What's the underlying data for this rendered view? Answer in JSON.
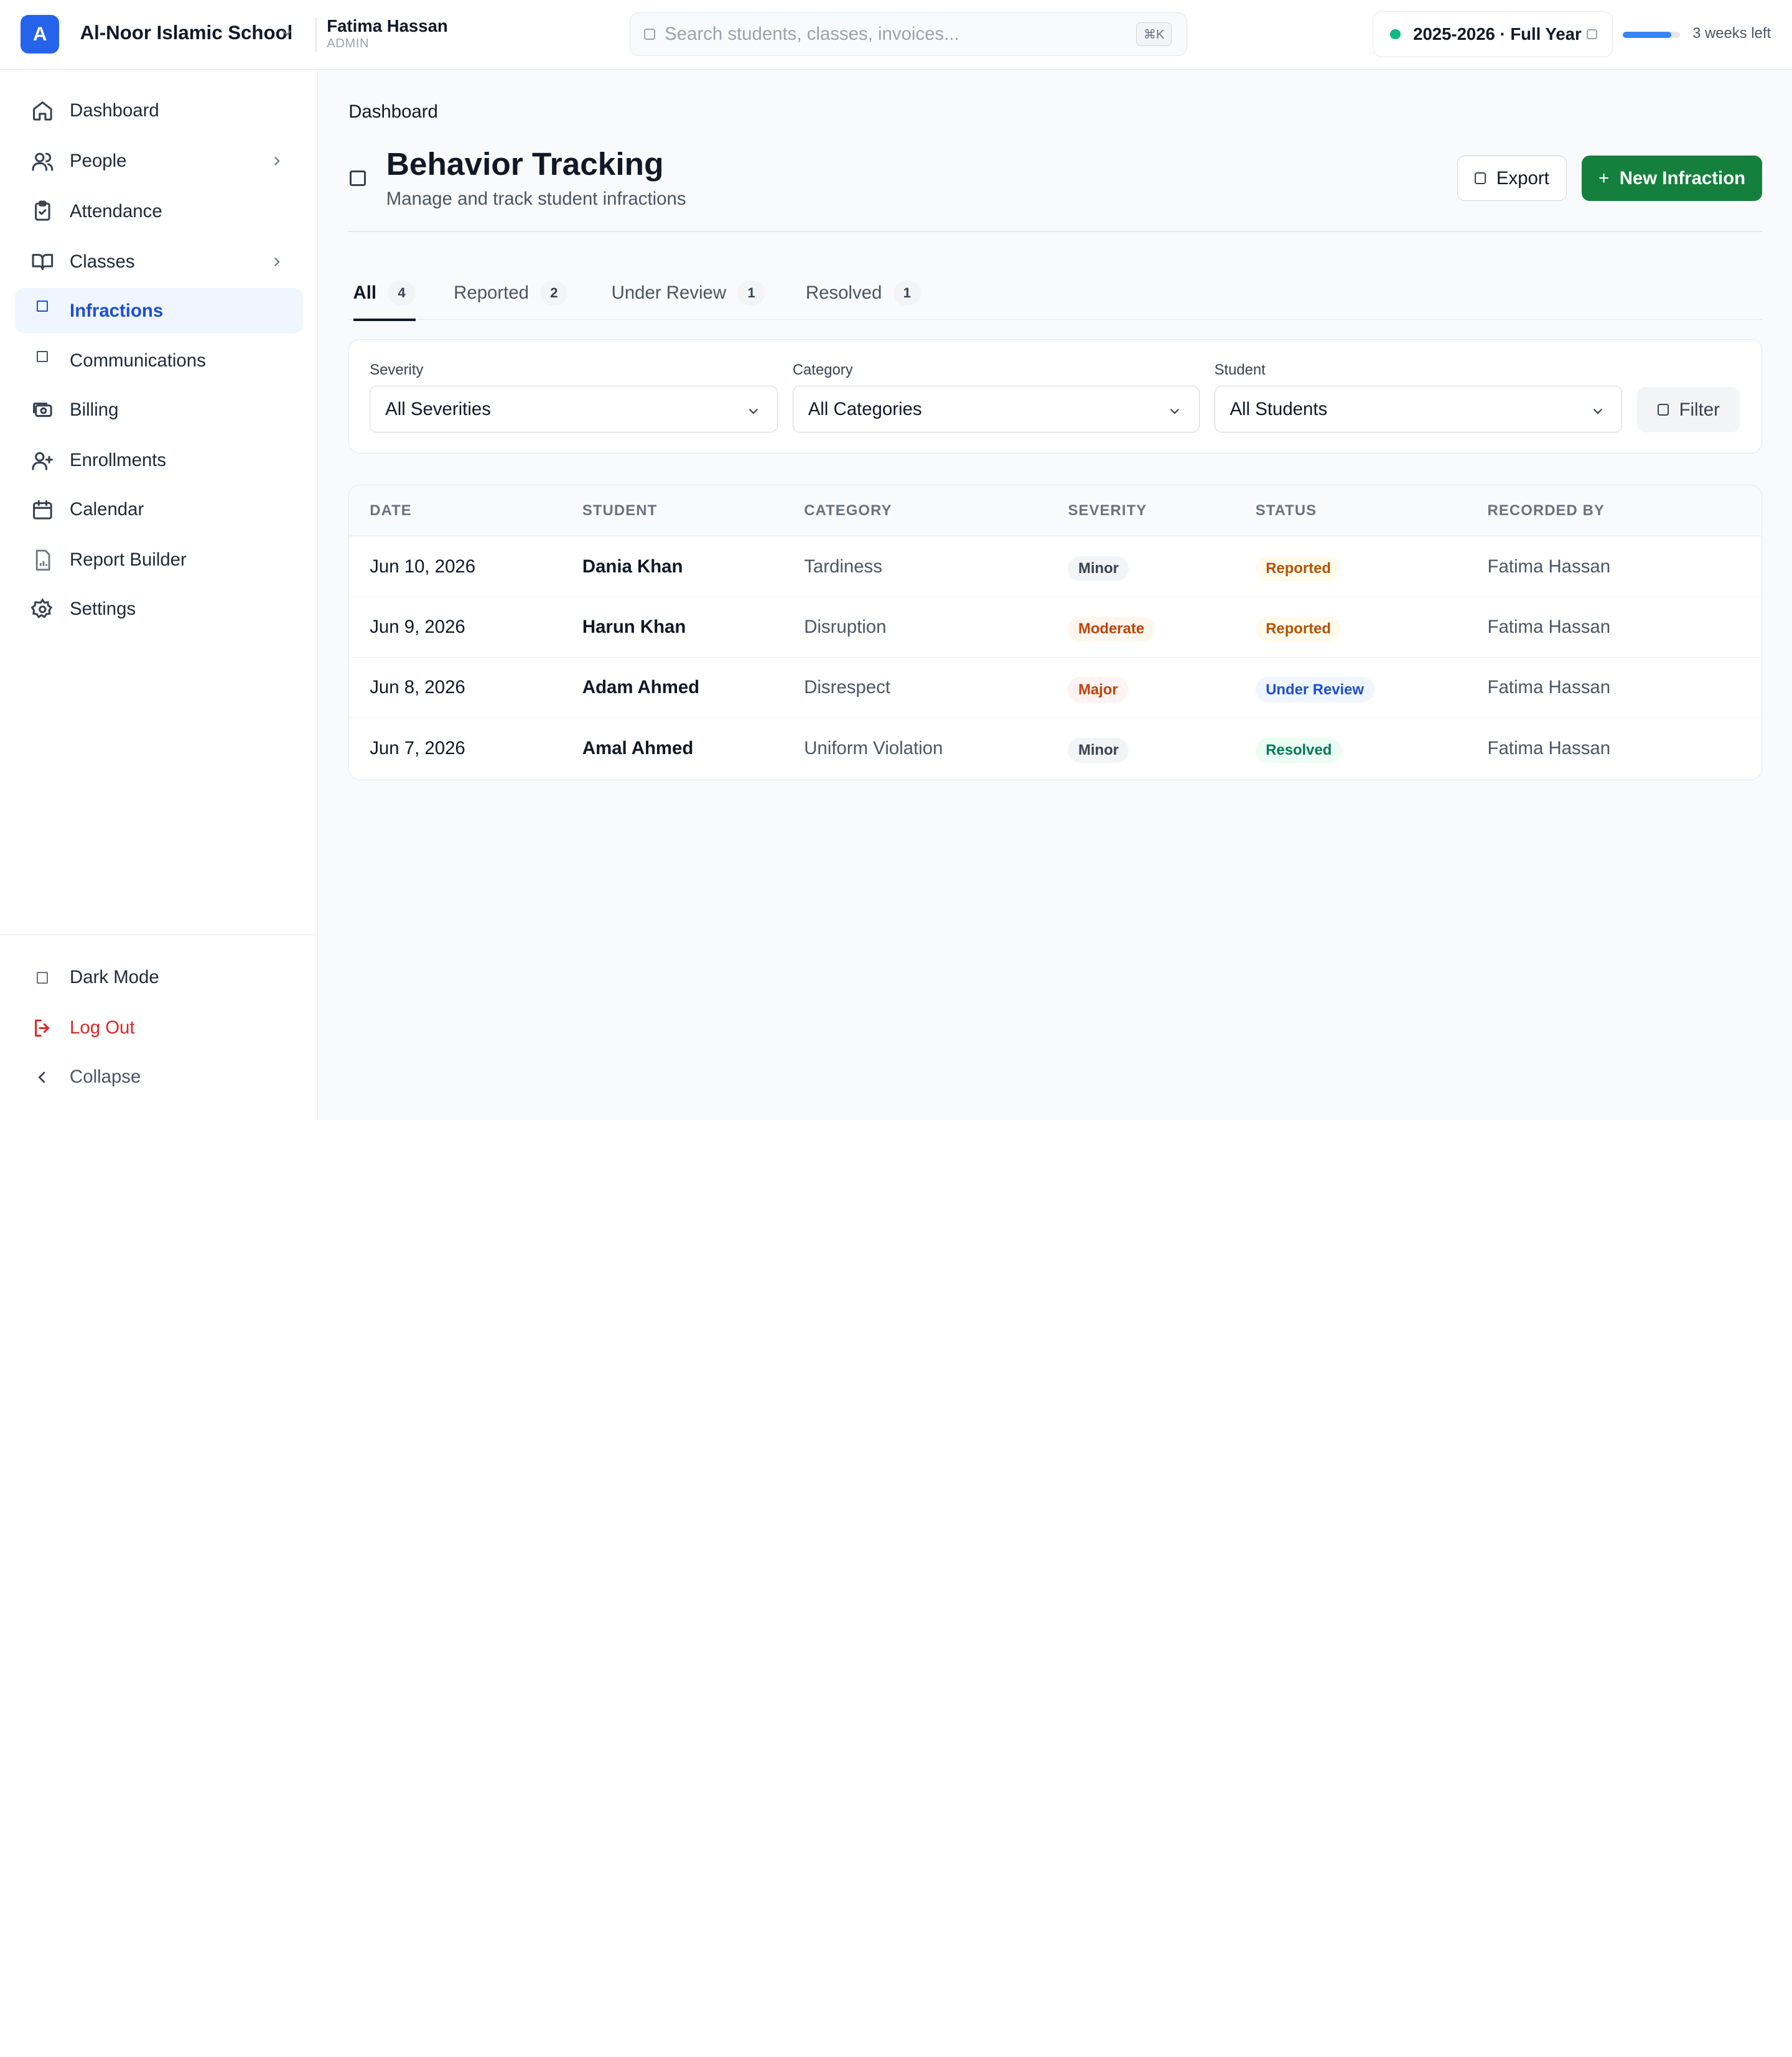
{
  "header": {
    "logo_letter": "A",
    "school_name": "Al-Noor Islamic School",
    "user_name": "Fatima Hassan",
    "user_role": "ADMIN",
    "search_placeholder": "Search students, classes, invoices...",
    "search_shortcut": "⌘K",
    "year_label": "2025-2026 · Full Year",
    "year_progress_percent": 85,
    "weeks_left": "3 weeks left"
  },
  "sidebar": {
    "items": [
      {
        "label": "Dashboard",
        "icon": "home-icon"
      },
      {
        "label": "People",
        "icon": "users-icon",
        "expandable": true
      },
      {
        "label": "Attendance",
        "icon": "clipboard-check-icon"
      },
      {
        "label": "Classes",
        "icon": "book-open-icon",
        "expandable": true
      },
      {
        "label": "Infractions",
        "icon": "square-icon",
        "active": true
      },
      {
        "label": "Communications",
        "icon": "square-icon"
      },
      {
        "label": "Billing",
        "icon": "banknote-icon"
      },
      {
        "label": "Enrollments",
        "icon": "user-plus-icon"
      },
      {
        "label": "Calendar",
        "icon": "calendar-icon"
      },
      {
        "label": "Report Builder",
        "icon": "file-chart-icon"
      },
      {
        "label": "Settings",
        "icon": "gear-icon"
      }
    ],
    "bottom": {
      "dark_mode": "Dark Mode",
      "log_out": "Log Out",
      "collapse": "Collapse"
    }
  },
  "page": {
    "breadcrumb": "Dashboard",
    "title": "Behavior Tracking",
    "subtitle": "Manage and track student infractions",
    "export_label": "Export",
    "new_label": "New Infraction",
    "new_prefix": "+"
  },
  "tabs": [
    {
      "label": "All",
      "count": "4",
      "active": true
    },
    {
      "label": "Reported",
      "count": "2"
    },
    {
      "label": "Under Review",
      "count": "1"
    },
    {
      "label": "Resolved",
      "count": "1"
    }
  ],
  "filters": {
    "severity": {
      "label": "Severity",
      "value": "All Severities"
    },
    "category": {
      "label": "Category",
      "value": "All Categories"
    },
    "student": {
      "label": "Student",
      "value": "All Students"
    },
    "filter_button": "Filter"
  },
  "table": {
    "columns": [
      "DATE",
      "STUDENT",
      "CATEGORY",
      "SEVERITY",
      "STATUS",
      "RECORDED BY"
    ],
    "rows": [
      {
        "date": "Jun 10, 2026",
        "student": "Dania Khan",
        "category": "Tardiness",
        "severity": "Minor",
        "status": "Reported",
        "recorded_by": "Fatima Hassan"
      },
      {
        "date": "Jun 9, 2026",
        "student": "Harun Khan",
        "category": "Disruption",
        "severity": "Moderate",
        "status": "Reported",
        "recorded_by": "Fatima Hassan"
      },
      {
        "date": "Jun 8, 2026",
        "student": "Adam Ahmed",
        "category": "Disrespect",
        "severity": "Major",
        "status": "Under Review",
        "recorded_by": "Fatima Hassan"
      },
      {
        "date": "Jun 7, 2026",
        "student": "Amal Ahmed",
        "category": "Uniform Violation",
        "severity": "Minor",
        "status": "Resolved",
        "recorded_by": "Fatima Hassan"
      }
    ]
  },
  "colors": {
    "brand": "#2563eb",
    "primary_action": "#15803d",
    "active_nav_bg": "#eff6ff",
    "danger": "#dc2626"
  }
}
